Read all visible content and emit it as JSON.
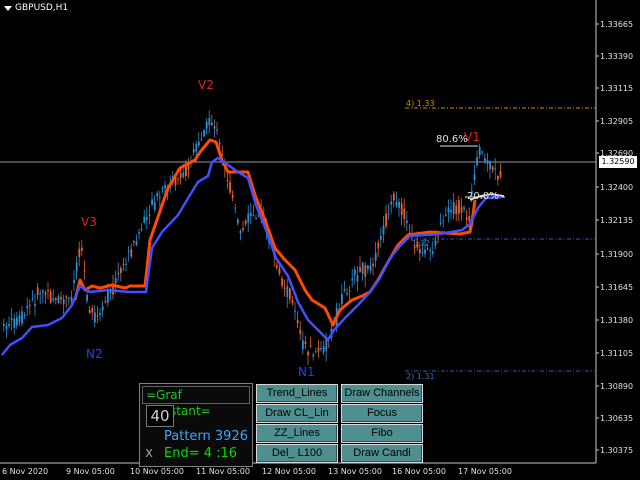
{
  "chart": {
    "symbol_title": "GBPUSD,H1",
    "current_price": "1.32590",
    "price_labels": [
      "1.33665",
      "1.33390",
      "1.33115",
      "1.32905",
      "1.32690",
      "1.32400",
      "1.32135",
      "1.31900",
      "1.31645",
      "1.31380",
      "1.31105",
      "1.30890",
      "1.30635",
      "1.30375"
    ],
    "time_labels": [
      "6 Nov 2020",
      "9 Nov 05:00",
      "10 Nov 05:00",
      "11 Nov 05:00",
      "12 Nov 05:00",
      "13 Nov 05:00",
      "16 Nov 05:00",
      "17 Nov 05:00"
    ],
    "wave_labels": {
      "v2": "V2",
      "v3": "V3",
      "v1": "V1",
      "n2": "N2",
      "n1": "N1"
    },
    "fibo_labels": {
      "top": "4)  1.33",
      "bottom": "2)  1.31",
      "pct_high": "80.6%",
      "pct_low": "20.0%",
      "mid": "1.32"
    },
    "colors": {
      "bull": "#2e8fd8",
      "bear": "#e56030",
      "orange_line": "#ff4a00",
      "blue_line": "#4050ff",
      "up_label": "#e02020",
      "down_label": "#2040ff"
    }
  },
  "panel": {
    "title": "=Graf Assistant=",
    "count": "40",
    "pattern": "Pattern 3926",
    "end": "End= 4 :16",
    "close": "X"
  },
  "buttons": {
    "trend_lines": "Trend_Lines",
    "draw_channels": "Draw Channels",
    "draw_cl_lin": "Draw CL_Lin",
    "focus": "Focus",
    "zz_lines": "ZZ_Lines",
    "fibo": "Fibo",
    "del_l100": "Del_ L100",
    "draw_candi": "Draw Candi"
  }
}
